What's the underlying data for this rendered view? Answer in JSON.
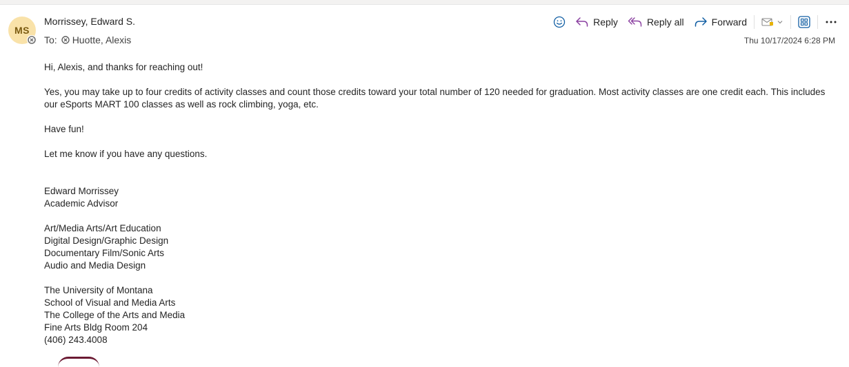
{
  "sender": {
    "initials": "MS",
    "name": "Morrissey, Edward S."
  },
  "recipients": {
    "label": "To:",
    "name": "Huotte, Alexis"
  },
  "toolbar": {
    "reply_label": "Reply",
    "reply_all_label": "Reply all",
    "forward_label": "Forward"
  },
  "timestamp": "Thu 10/17/2024 6:28 PM",
  "message": {
    "greeting": "Hi, Alexis, and thanks for reaching out!",
    "paragraph1": "Yes, you may take up to four credits of activity classes and count those credits toward your total number of 120 needed for graduation. Most activity classes are one credit each. This includes our eSports MART 100 classes as well as rock climbing, yoga, etc.",
    "paragraph2": "Have fun!",
    "paragraph3": "Let me know if you have any questions."
  },
  "signature": {
    "name": "Edward Morrissey",
    "title": "Academic Advisor",
    "programs": [
      "Art/Media Arts/Art Education",
      "Digital Design/Graphic Design",
      "Documentary Film/Sonic Arts",
      "Audio and Media Design"
    ],
    "address": [
      "The University of Montana",
      "School of Visual and Media Arts",
      "The College of the Arts and Media",
      "Fine Arts Bldg Room 204",
      "(406) 243.4008"
    ]
  },
  "colors": {
    "accent": "#115ea3",
    "avatar_bg": "#f9e2a9",
    "reply_purple": "#8a3fa0"
  }
}
